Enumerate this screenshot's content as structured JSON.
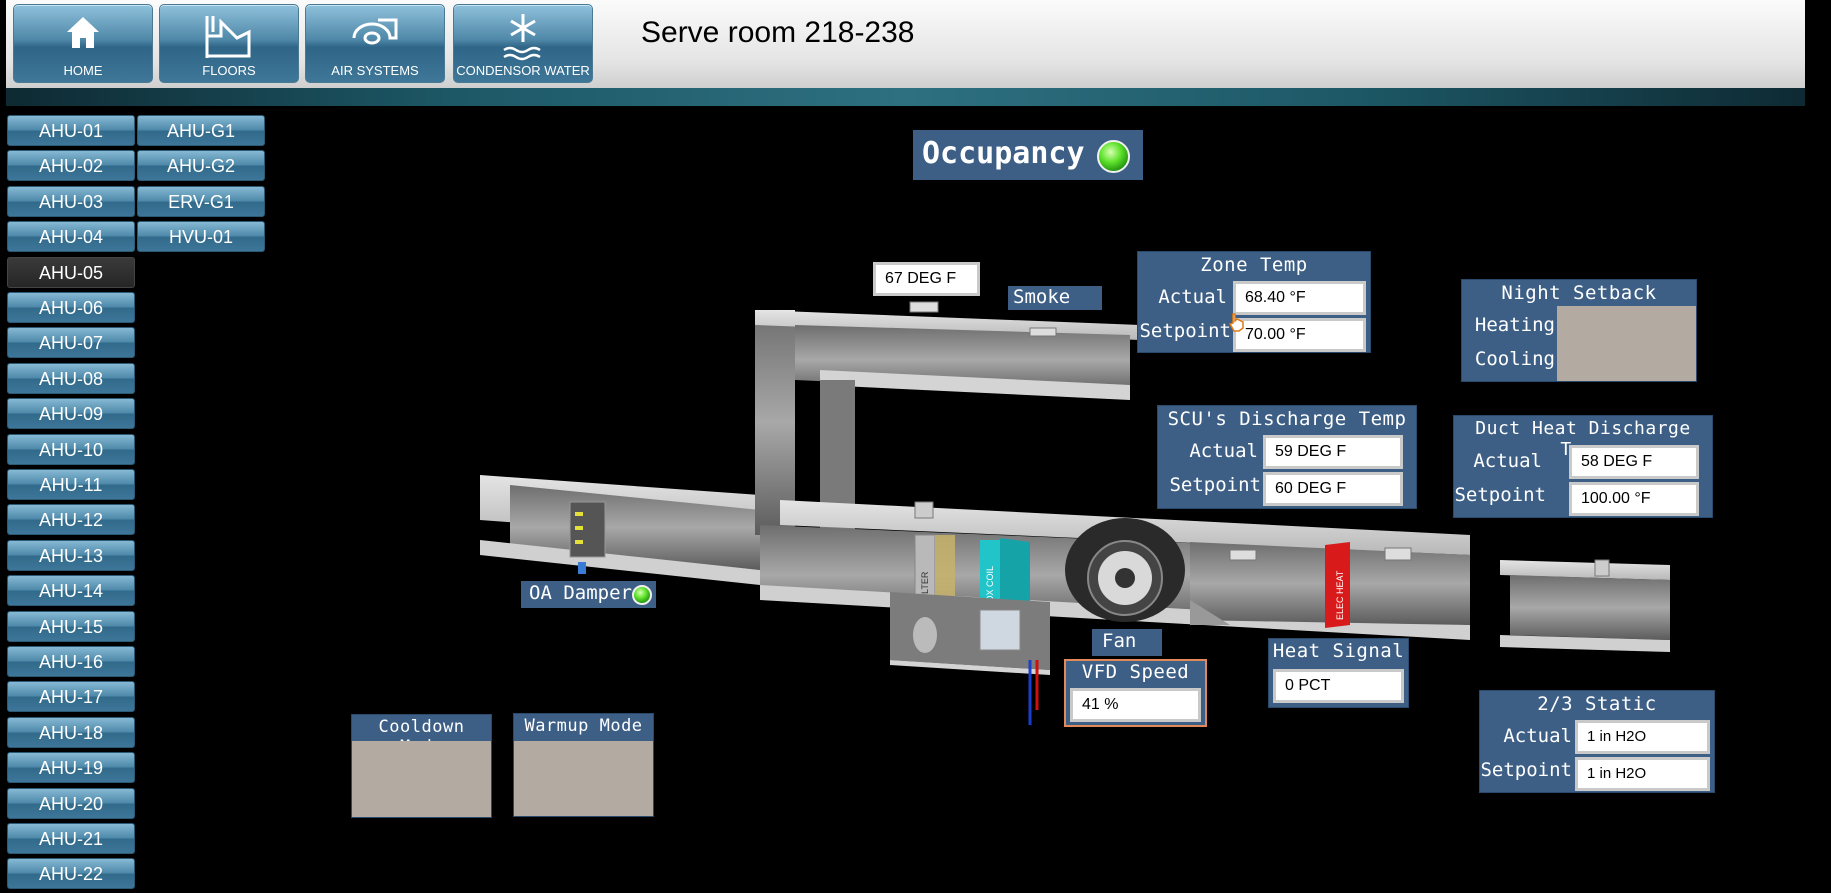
{
  "nav": {
    "buttons": [
      {
        "label": "HOME",
        "icon": "home-icon"
      },
      {
        "label": "FLOORS",
        "icon": "floors-icon"
      },
      {
        "label": "AIR SYSTEMS",
        "icon": "fan-icon"
      },
      {
        "label": "CONDENSOR WATER",
        "icon": "snowflake-water-icon"
      }
    ]
  },
  "page_title": "Serve room 218-238",
  "sidebar": {
    "col1": [
      "AHU-01",
      "AHU-02",
      "AHU-03",
      "AHU-04",
      "AHU-05",
      "AHU-06",
      "AHU-07",
      "AHU-08",
      "AHU-09",
      "AHU-10",
      "AHU-11",
      "AHU-12",
      "AHU-13",
      "AHU-14",
      "AHU-15",
      "AHU-16",
      "AHU-17",
      "AHU-18",
      "AHU-19",
      "AHU-20",
      "AHU-21",
      "AHU-22"
    ],
    "col2": [
      "AHU-G1",
      "AHU-G2",
      "ERV-G1",
      "HVU-01"
    ],
    "active": "AHU-05"
  },
  "occupancy": {
    "label": "Occupancy",
    "status_color": "#44d41c"
  },
  "supply_temp": "67 DEG F",
  "smoke_label": "Smoke",
  "zone_temp": {
    "title": "Zone Temp",
    "actual_label": "Actual",
    "actual": "68.40 °F",
    "setpoint_label": "Setpoint",
    "setpoint": "70.00 °F"
  },
  "night_setback": {
    "title": "Night Setback",
    "heating_label": "Heating",
    "cooling_label": "Cooling"
  },
  "scu_discharge": {
    "title": "SCU's Discharge Temp",
    "actual_label": "Actual",
    "actual": "59 DEG F",
    "setpoint_label": "Setpoint",
    "setpoint": "60 DEG F"
  },
  "duct_heat": {
    "title": "Duct Heat Discharge Temp",
    "actual_label": "Actual",
    "actual": "58 DEG F",
    "setpoint_label": "Setpoint",
    "setpoint": "100.00 °F"
  },
  "oa_damper": {
    "label": "OA Damper",
    "status_color": "#44d41c"
  },
  "equipment_labels": {
    "filter": "FILTER",
    "dx_coil": "DX COIL",
    "elec_heat": "ELEC HEAT"
  },
  "fan_label": "Fan",
  "vfd_speed": {
    "title": "VFD Speed",
    "value": "41 %"
  },
  "heat_signal": {
    "title": "Heat Signal",
    "value": "0 PCT"
  },
  "static": {
    "title": "2/3 Static",
    "actual_label": "Actual",
    "actual": "1 in H2O",
    "setpoint_label": "Setpoint",
    "setpoint": "1 in H2O"
  },
  "cooldown_mode": {
    "title": "Cooldown Mode"
  },
  "warmup_mode": {
    "title": "Warmup Mode"
  }
}
